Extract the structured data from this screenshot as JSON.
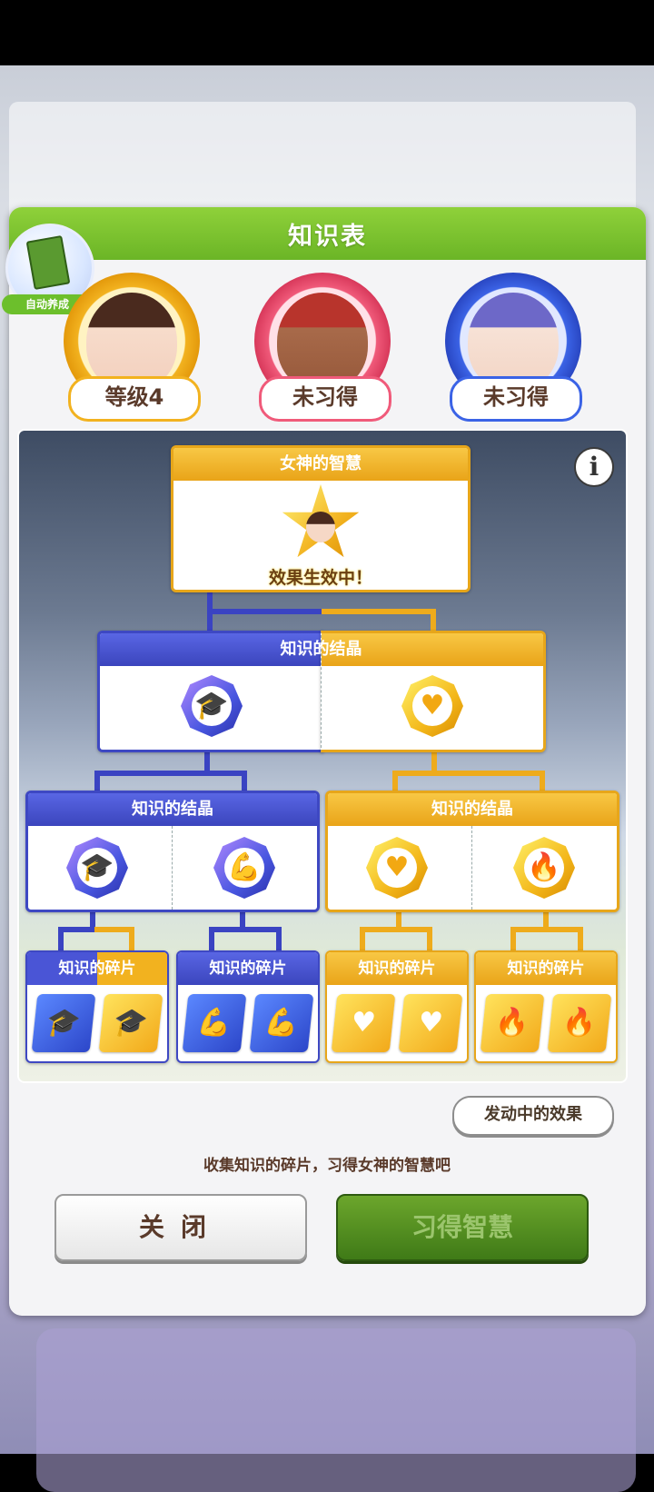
{
  "panel": {
    "title": "知识表",
    "auto_badge": "自动养成"
  },
  "characters": [
    {
      "status": "等级4",
      "ring_color": "#f2b21f"
    },
    {
      "status": "未习得",
      "ring_color": "#f05a7a"
    },
    {
      "status": "未习得",
      "ring_color": "#3b63e6"
    }
  ],
  "tree": {
    "top": {
      "title": "女神的智慧",
      "status": "效果生效中！"
    },
    "crystal_top": {
      "title": "知识的结晶"
    },
    "crystal_left": {
      "title": "知识的结晶"
    },
    "crystal_right": {
      "title": "知识的结晶"
    },
    "fragments": [
      {
        "title": "知识的碎片"
      },
      {
        "title": "知识的碎片"
      },
      {
        "title": "知识的碎片"
      },
      {
        "title": "知识的碎片"
      }
    ],
    "icons": {
      "hat": "🎓",
      "muscle": "💪",
      "heart": "♥",
      "fire": "🔥"
    }
  },
  "buttons": {
    "active_effects": "发动中的效果",
    "close": "关闭",
    "learn": "习得智慧"
  },
  "hint": "收集知识的碎片，习得女神的智慧吧",
  "colors": {
    "header_green": "#6bb526",
    "gold": "#e9a418",
    "blue": "#3b45bd"
  }
}
